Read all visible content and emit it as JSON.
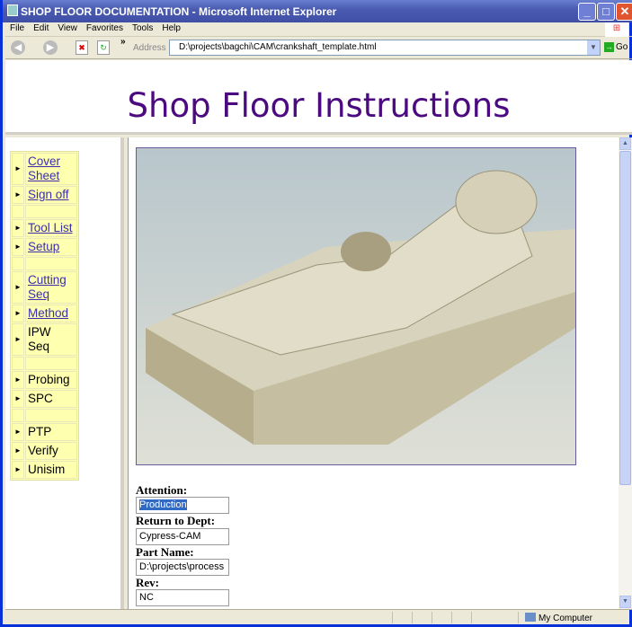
{
  "window": {
    "title": "SHOP FLOOR DOCUMENTATION - Microsoft Internet Explorer"
  },
  "menu": [
    "File",
    "Edit",
    "View",
    "Favorites",
    "Tools",
    "Help"
  ],
  "toolbar": {
    "address_label": "Address",
    "address": "D:\\projects\\bagchi\\CAM\\crankshaft_template.html",
    "go_label": "Go",
    "chevron": "»"
  },
  "header": {
    "title": "Shop Floor Instructions"
  },
  "nav": [
    {
      "label": "Cover Sheet",
      "link": true
    },
    {
      "label": "Sign off",
      "link": true
    },
    null,
    {
      "label": "Tool List",
      "link": true
    },
    {
      "label": "Setup",
      "link": true
    },
    null,
    {
      "label": "Cutting Seq",
      "link": true
    },
    {
      "label": "Method",
      "link": true
    },
    {
      "label": "IPW Seq",
      "link": false
    },
    null,
    {
      "label": "Probing",
      "link": false
    },
    {
      "label": "SPC",
      "link": false
    },
    null,
    {
      "label": "PTP",
      "link": false
    },
    {
      "label": "Verify",
      "link": false
    },
    {
      "label": "Unisim",
      "link": false
    }
  ],
  "form": {
    "attention_label": "Attention:",
    "attention": "Production",
    "dept_label": "Return to Dept:",
    "dept": "Cypress-CAM",
    "part_label": "Part Name:",
    "part": "D:\\projects\\process",
    "rev_label": "Rev:",
    "rev": "NC"
  },
  "status": {
    "zone": "My Computer"
  },
  "colors": {
    "title": "#4b0a80",
    "link": "#3b2fb0",
    "nav_bg": "#ffffb0"
  }
}
